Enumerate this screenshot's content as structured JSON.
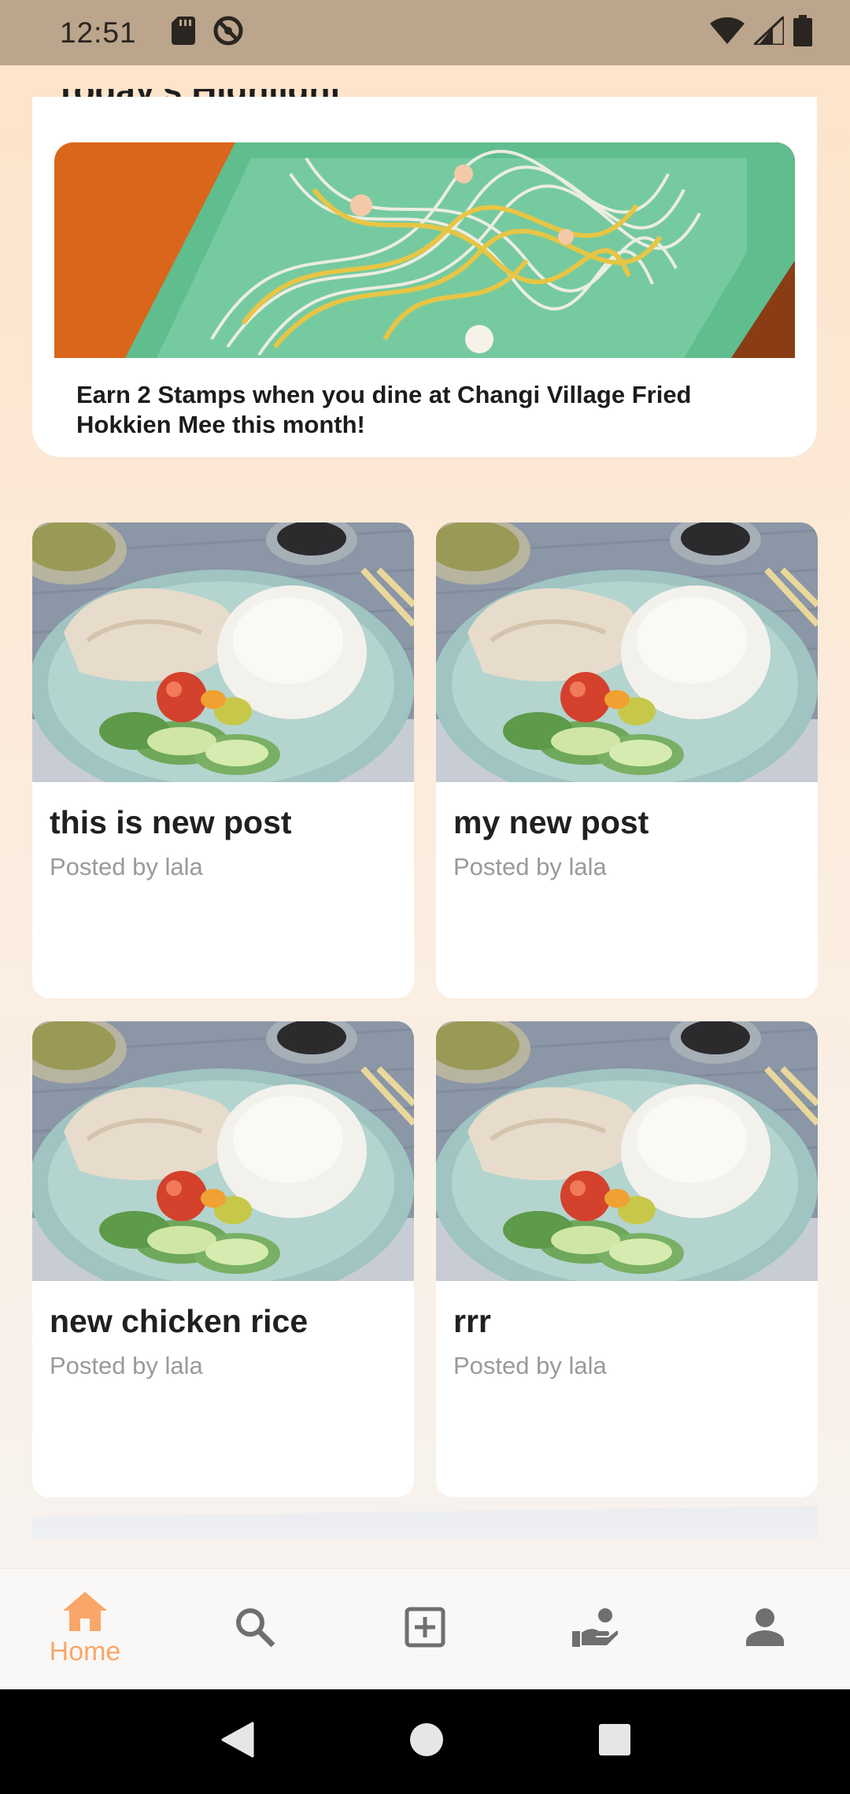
{
  "status_bar": {
    "time": "12:51",
    "left_icons": [
      "sd-card-icon",
      "do-not-disturb-icon"
    ],
    "right_icons": [
      "wifi-icon",
      "cellular-signal-icon",
      "battery-icon"
    ]
  },
  "highlight": {
    "title": "Today's Highlight",
    "image": "fried-hokkien-mee-photo",
    "text": "Earn 2 Stamps when you dine at Changi Village Fried Hokkien Mee this month!"
  },
  "posts": [
    {
      "title": "this is new post",
      "author": "Posted by lala",
      "image": "chicken-rice-photo"
    },
    {
      "title": "my new post",
      "author": "Posted by lala",
      "image": "chicken-rice-photo"
    },
    {
      "title": "new chicken rice",
      "author": "Posted by lala",
      "image": "chicken-rice-photo"
    },
    {
      "title": "rrr",
      "author": "Posted by lala",
      "image": "chicken-rice-photo"
    }
  ],
  "bottom_nav": {
    "active": "home",
    "items": [
      {
        "id": "home",
        "label": "Home",
        "icon": "home-icon"
      },
      {
        "id": "search",
        "label": "",
        "icon": "search-icon"
      },
      {
        "id": "add",
        "label": "",
        "icon": "add-box-icon"
      },
      {
        "id": "rewards",
        "label": "",
        "icon": "rewards-hand-icon"
      },
      {
        "id": "profile",
        "label": "",
        "icon": "person-icon"
      }
    ]
  },
  "colors": {
    "accent": "#f9a66a",
    "status_bar": "#bba58c",
    "inactive_icon": "#6f6f6f"
  }
}
